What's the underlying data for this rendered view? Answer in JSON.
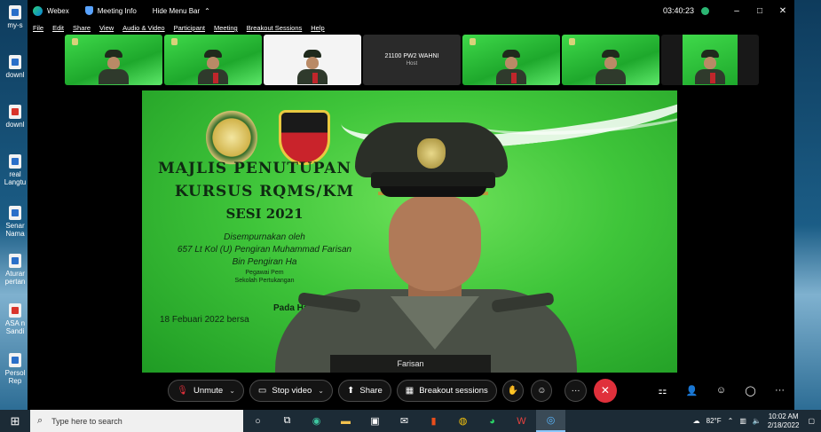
{
  "window": {
    "app_name": "Webex",
    "meeting_info": "Meeting Info",
    "hide_menu": "Hide Menu Bar",
    "time": "03:40:23"
  },
  "menu": [
    "File",
    "Edit",
    "Share",
    "View",
    "Audio & Video",
    "Participant",
    "Meeting",
    "Breakout Sessions",
    "Help"
  ],
  "desktop_icons": [
    {
      "label": "my-s",
      "type": "doc"
    },
    {
      "label": "downl",
      "type": "doc"
    },
    {
      "label": "downl",
      "type": "pdf"
    },
    {
      "label": "real Langtu",
      "type": "doc"
    },
    {
      "label": "Senar Nama",
      "type": "doc"
    },
    {
      "label": "Aturar pertan",
      "type": "doc"
    },
    {
      "label": "ASA n Sandi",
      "type": "pdf"
    },
    {
      "label": "Persol Rep",
      "type": "doc"
    }
  ],
  "participants": [
    {
      "kind": "video"
    },
    {
      "kind": "video"
    },
    {
      "kind": "video-white"
    },
    {
      "kind": "host",
      "name": "21100 PW2 WAHNI",
      "role": "Host"
    },
    {
      "kind": "video"
    },
    {
      "kind": "video"
    },
    {
      "kind": "video-dark"
    }
  ],
  "stage": {
    "line1": "MAJLIS PENUTUPAN R",
    "line2": "KURSUS RQMS/KM",
    "line3": "SESI 2021",
    "line4": "Disempurnakan oleh",
    "line5": "657 Lt Kol (U) Pengiran Muhammad Farisan",
    "line6": "Bin Pengiran Ha",
    "line7": "Pegawai Pem",
    "line8": "Sekolah Pertukangan",
    "line9": "Pada Hari",
    "line10": "18 Febuari 2022 bersa",
    "speaker_name": "Farisan"
  },
  "controls": {
    "mute": "Unmute",
    "video": "Stop video",
    "share": "Share",
    "breakout": "Breakout sessions",
    "more": "···",
    "end": "✕"
  },
  "taskbar": {
    "search_placeholder": "Type here to search",
    "temp": "82°F",
    "clock_time": "10:02 AM",
    "clock_date": "2/18/2022"
  },
  "colors": {
    "end_call": "#e0303b",
    "banner_green": "#3fc53a",
    "webex_accent": "#2bb673"
  }
}
